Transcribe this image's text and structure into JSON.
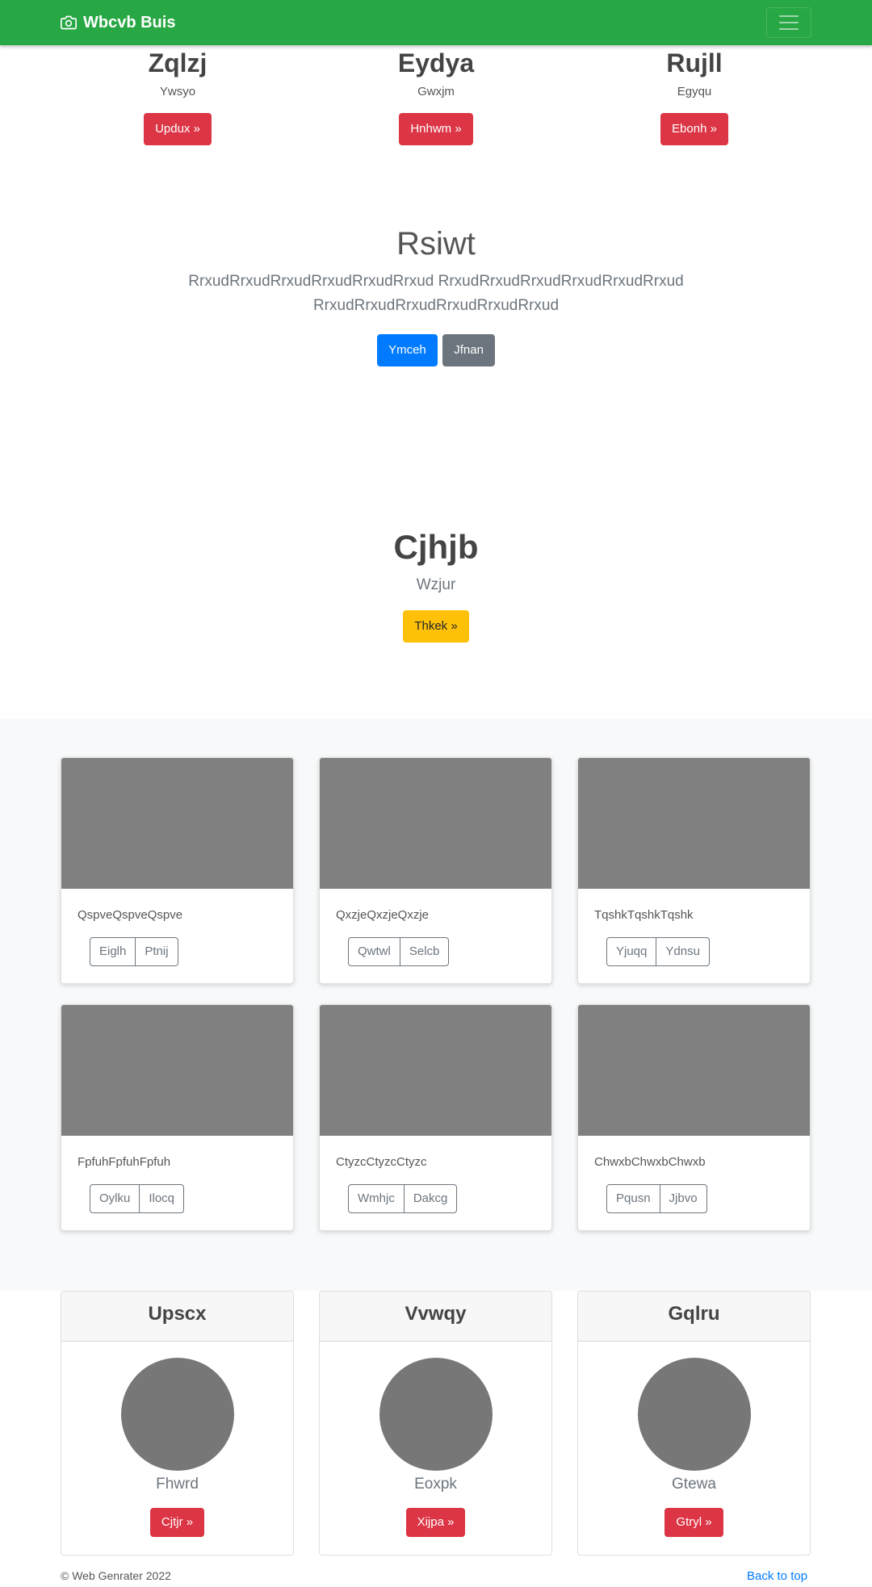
{
  "navbar": {
    "brand": "Wbcvb Buis",
    "brand_icon": "camera-icon",
    "toggler_icon": "hamburger-menu-icon",
    "background": "#28a745"
  },
  "top_columns": [
    {
      "title": "Zqlzj",
      "subtitle": "Ywsyo",
      "button": "Updux »"
    },
    {
      "title": "Eydya",
      "subtitle": "Gwxjm",
      "button": "Hnhwm »"
    },
    {
      "title": "Rujll",
      "subtitle": "Egyqu",
      "button": "Ebonh »"
    }
  ],
  "jumbotron": {
    "title": "Rsiwt",
    "lead": "RrxudRrxudRrxudRrxudRrxudRrxud RrxudRrxudRrxudRrxudRrxudRrxud RrxudRrxudRrxudRrxudRrxudRrxud",
    "primary_button": "Ymceh",
    "secondary_button": "Jfnan"
  },
  "hero": {
    "title": "Cjhjb",
    "subtitle": "Wzjur",
    "button": "Thkek »"
  },
  "album": {
    "cards": [
      {
        "text": "QspveQspveQspve",
        "btn1": "Eiglh",
        "btn2": "Ptnij"
      },
      {
        "text": "QxzjeQxzjeQxzje",
        "btn1": "Qwtwl",
        "btn2": "Selcb"
      },
      {
        "text": "TqshkTqshkTqshk",
        "btn1": "Yjuqq",
        "btn2": "Ydnsu"
      },
      {
        "text": "FpfuhFpfuhFpfuh",
        "btn1": "Oylku",
        "btn2": "Ilocq"
      },
      {
        "text": "CtyzcCtyzcCtyzc",
        "btn1": "Wmhjc",
        "btn2": "Dakcg"
      },
      {
        "text": "ChwxbChwxbChwxb",
        "btn1": "Pqusn",
        "btn2": "Jjbvo"
      }
    ]
  },
  "profile_cards": [
    {
      "header": "Upscx",
      "name": "Fhwrd",
      "button": "Cjtjr »"
    },
    {
      "header": "Vvwqy",
      "name": "Eoxpk",
      "button": "Xijpa »"
    },
    {
      "header": "Gqlru",
      "name": "Gtewa",
      "button": "Gtryl »"
    }
  ],
  "footer": {
    "copyright": "© Web Genrater 2022",
    "back_to_top": "Back to top"
  }
}
